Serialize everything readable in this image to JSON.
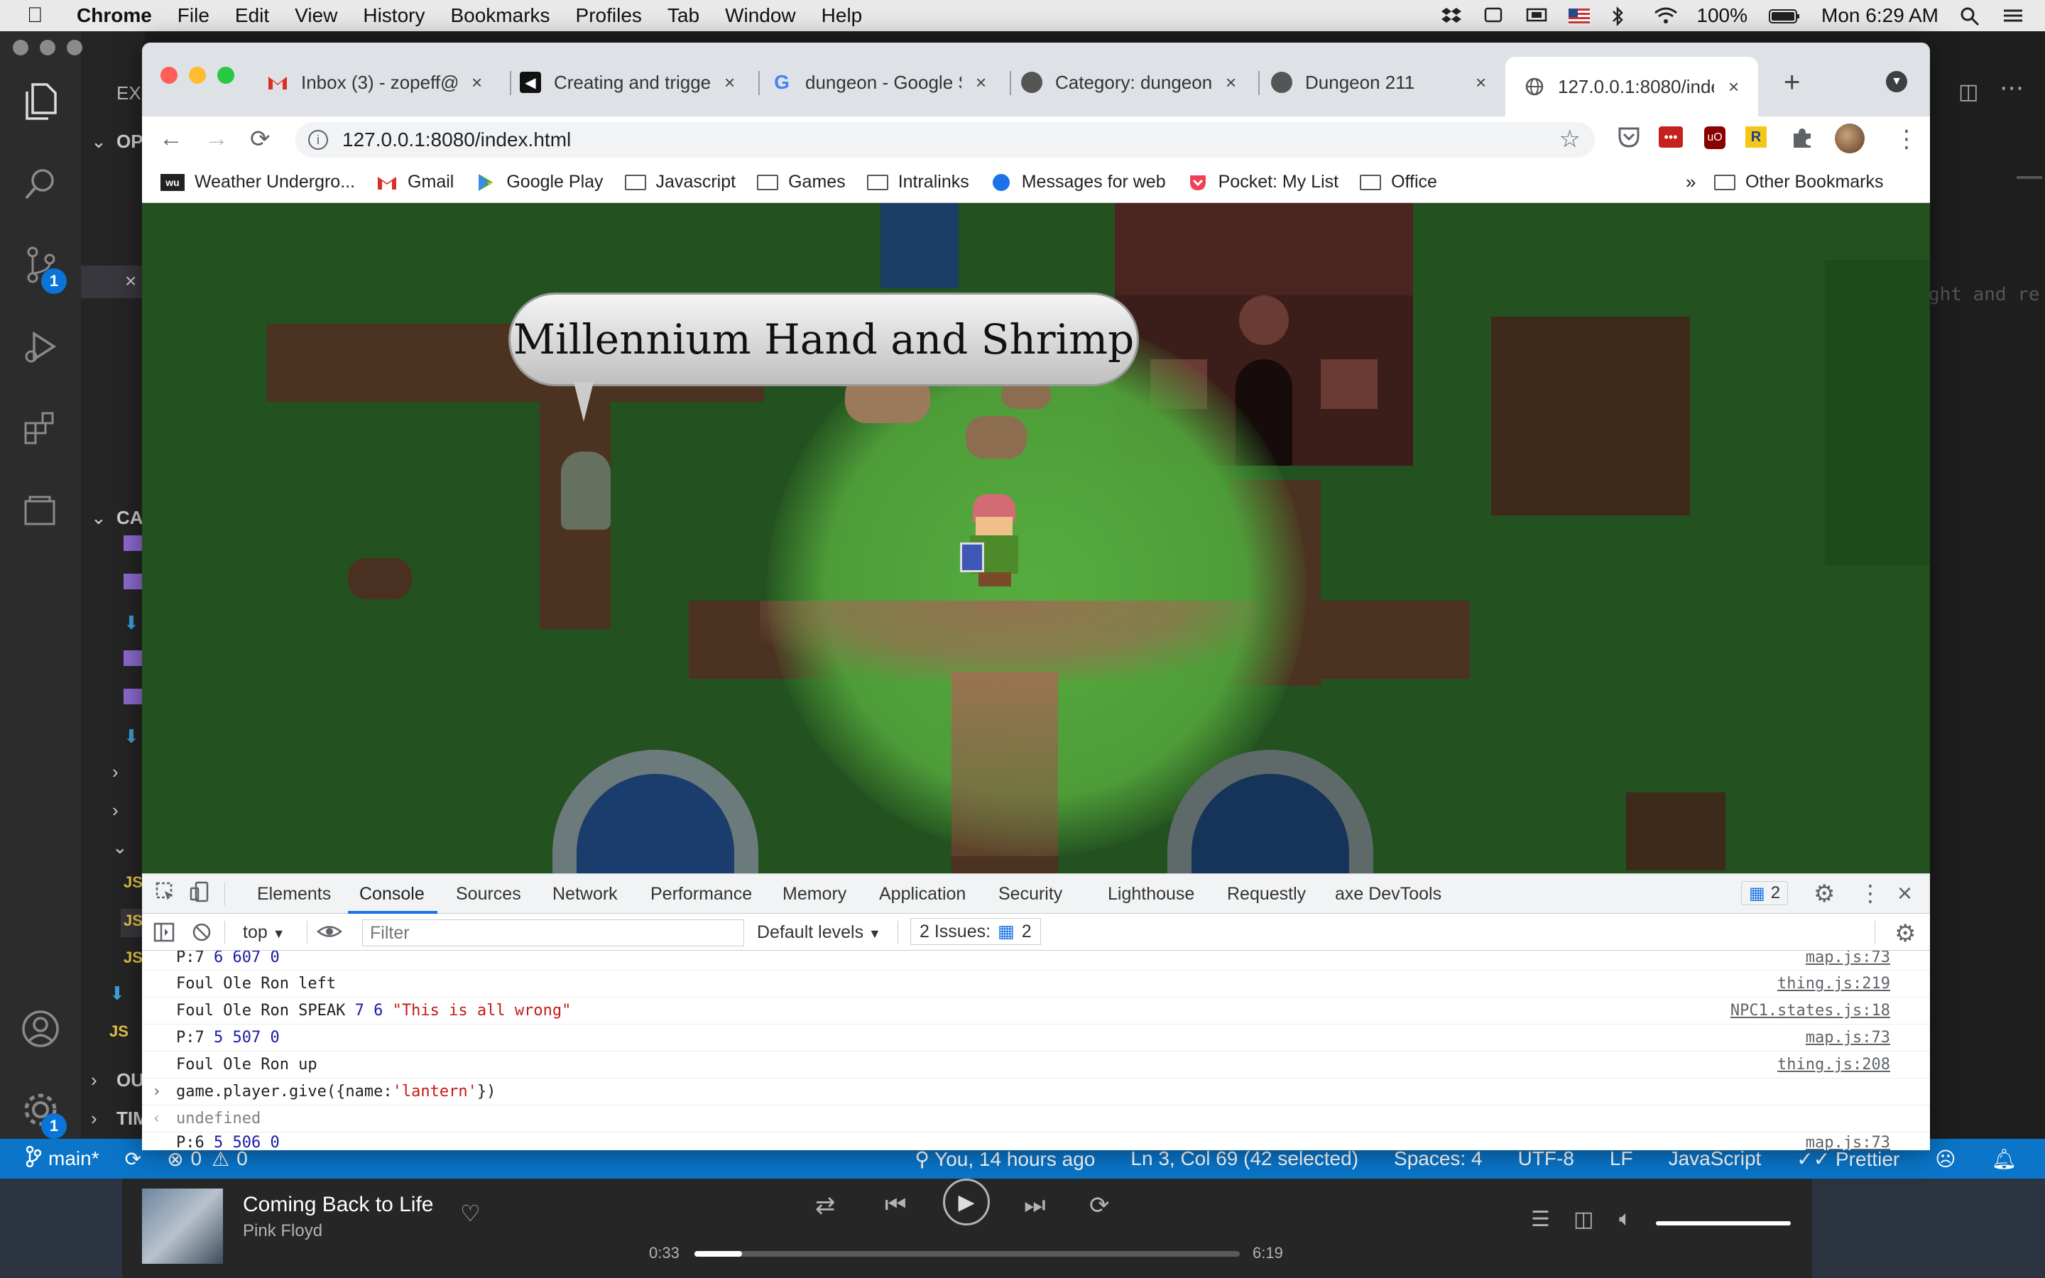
{
  "menubar": {
    "app": "Chrome",
    "items": [
      "File",
      "Edit",
      "View",
      "History",
      "Bookmarks",
      "Profiles",
      "Tab",
      "Window",
      "Help"
    ],
    "battery": "100%",
    "clock": "Mon 6:29 AM"
  },
  "vscode": {
    "sidebar_sections": [
      "EX",
      "OP",
      "CA",
      "OU",
      "TIM"
    ],
    "code_fragment": "ght and re",
    "source_control_badge": "1",
    "settings_badge": "1",
    "status": {
      "branch": "main*",
      "errors": "0",
      "warnings": "0",
      "blame": "You, 14 hours ago",
      "cursor": "Ln 3, Col 69 (42 selected)",
      "spaces": "Spaces: 4",
      "encoding": "UTF-8",
      "eol": "LF",
      "language": "JavaScript",
      "formatter": "Prettier"
    }
  },
  "chrome": {
    "tabs": [
      {
        "title": "Inbox (3) - zopeff@",
        "icon": "gmail-icon"
      },
      {
        "title": "Creating and trigger",
        "icon": "page-icon"
      },
      {
        "title": "dungeon - Google S",
        "icon": "google-icon"
      },
      {
        "title": "Category: dungeon",
        "icon": "wiki-icon"
      },
      {
        "title": "Dungeon 211",
        "icon": "wiki-icon"
      },
      {
        "title": "127.0.0.1:8080/inde",
        "icon": "globe-icon",
        "active": true
      }
    ],
    "url": "127.0.0.1:8080/index.html",
    "bookmarks": [
      "Weather Undergro...",
      "Gmail",
      "Google Play",
      "Javascript",
      "Games",
      "Intralinks",
      "Messages for web",
      "Pocket: My List",
      "Office"
    ],
    "other_bookmarks": "Other Bookmarks"
  },
  "game": {
    "speech_bubble": "Millennium Hand and Shrimp"
  },
  "devtools": {
    "tabs": [
      "Elements",
      "Console",
      "Sources",
      "Network",
      "Performance",
      "Memory",
      "Application",
      "Security",
      "Lighthouse",
      "Requestly",
      "axe DevTools"
    ],
    "active_tab": "Console",
    "issues_badge": "2",
    "context": "top",
    "filter_placeholder": "Filter",
    "levels": "Default levels",
    "issues_label": "2 Issues:",
    "issues_count": "2",
    "console": [
      {
        "text": "P:7 6 607 0",
        "source": "map.js:73"
      },
      {
        "text": "Foul Ole Ron left",
        "source": "thing.js:219"
      },
      {
        "text": "Foul Ole Ron SPEAK 7 6 \"This is all wrong\"",
        "source": "NPC1.states.js:18"
      },
      {
        "text": "P:7 5 507 0",
        "source": "map.js:73"
      },
      {
        "text": "Foul Ole Ron up",
        "source": "thing.js:208"
      },
      {
        "text": "game.player.give({name:'lantern'})",
        "source": "",
        "kind": "input"
      },
      {
        "text": "undefined",
        "source": "",
        "kind": "result"
      },
      {
        "text": "P:6 5 506 0",
        "source": "map.js:73"
      }
    ]
  },
  "player": {
    "song": "Coming Back to Life",
    "artist": "Pink Floyd",
    "elapsed": "0:33",
    "duration": "6:19",
    "progress": 0.087
  }
}
